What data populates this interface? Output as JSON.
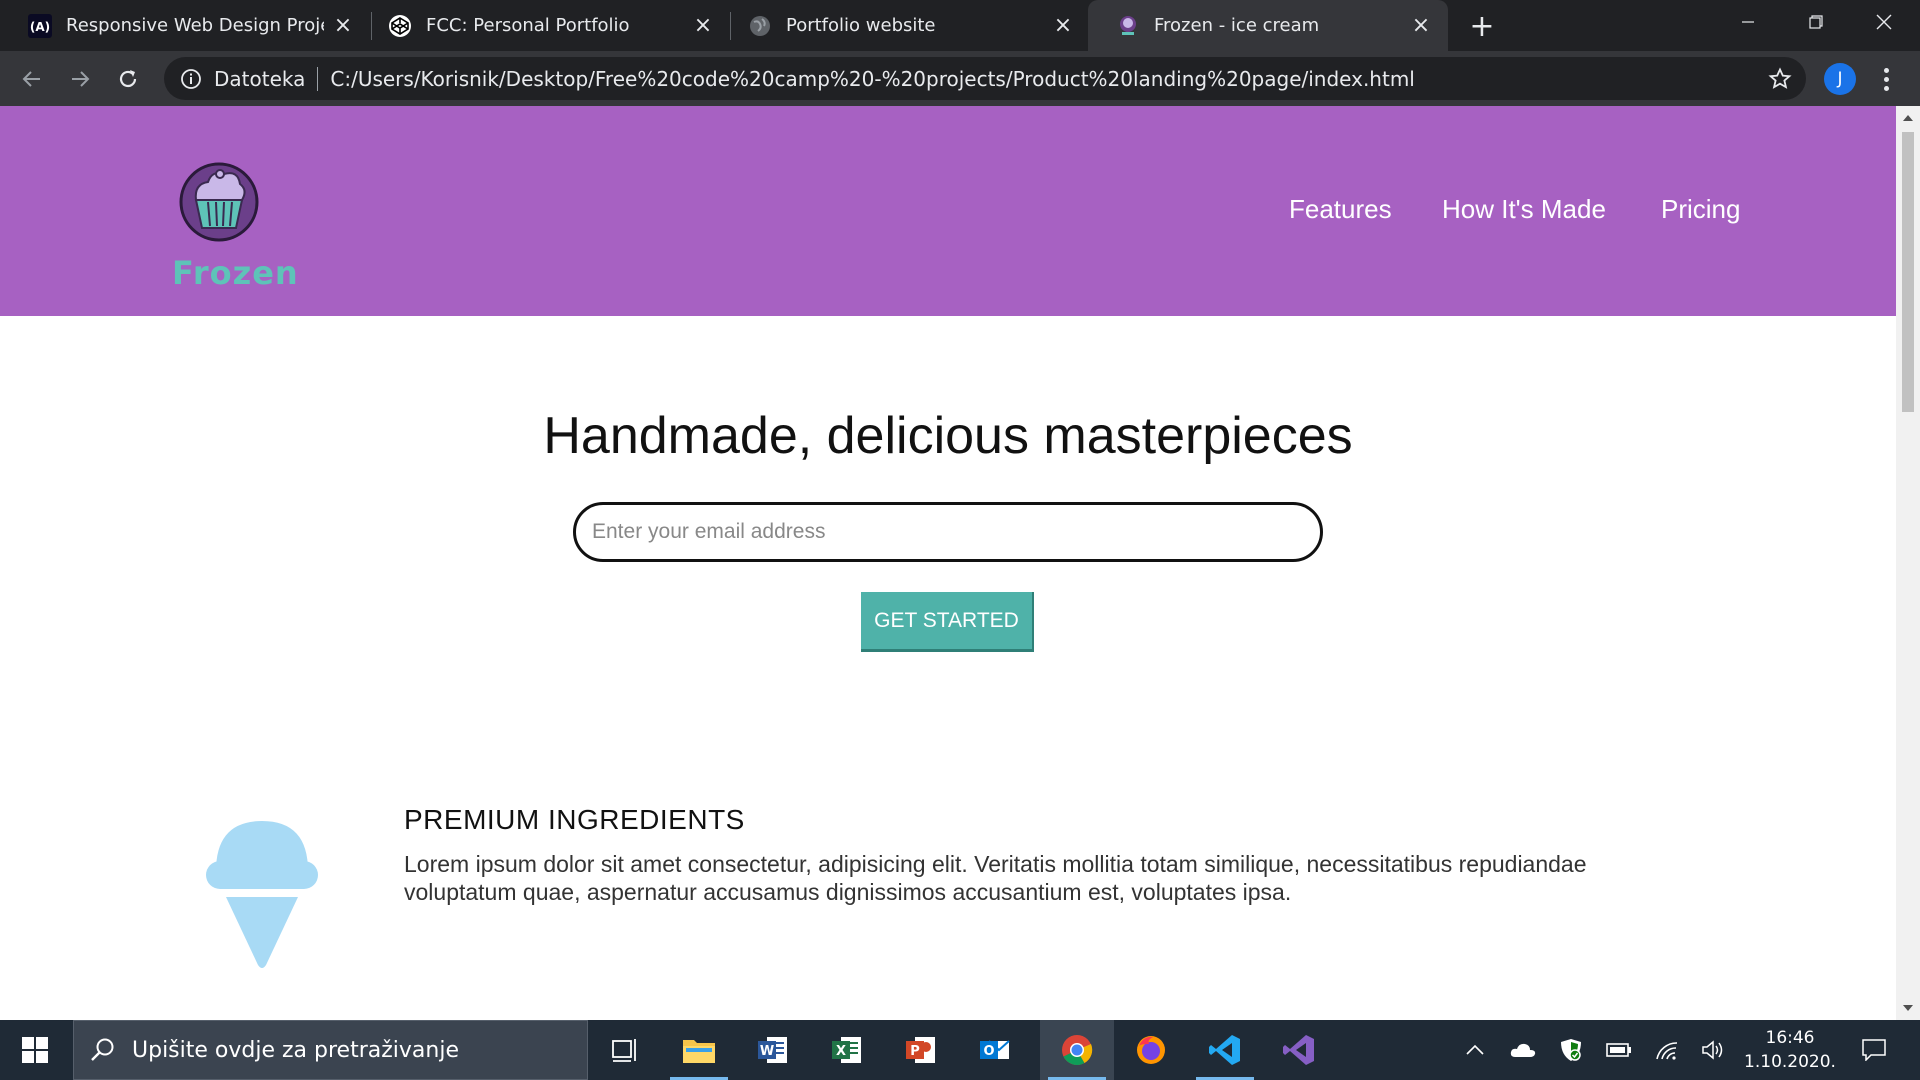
{
  "browser": {
    "tabs": [
      {
        "title": "Responsive Web Design Projects",
        "favicon": "freecodecamp-icon",
        "active": false
      },
      {
        "title": "FCC: Personal Portfolio",
        "favicon": "codepen-icon",
        "active": false
      },
      {
        "title": "Portfolio website",
        "favicon": "globe-icon",
        "active": false
      },
      {
        "title": "Frozen - ice cream",
        "favicon": "frozen-icon",
        "active": true
      }
    ],
    "scheme_label": "Datoteka",
    "url": "C:/Users/Korisnik/Desktop/Free%20code%20camp%20-%20projects/Product%20landing%20page/index.html",
    "profile_initial": "J"
  },
  "site": {
    "brand": "Frozen",
    "nav": [
      "Features",
      "How It's Made",
      "Pricing"
    ],
    "hero_title": "Handmade, delicious masterpieces",
    "email_placeholder": "Enter your email address",
    "cta_label": "GET STARTED",
    "feature": {
      "heading": "PREMIUM INGREDIENTS",
      "text": "Lorem ipsum dolor sit amet consectetur, adipisicing elit. Veritatis mollitia totam similique, necessitatibus repudiandae voluptatum quae, aspernatur accusamus dignissimos accusantium est, voluptates ipsa."
    },
    "colors": {
      "header": "#a761c2",
      "cta": "#4fb2a9",
      "brand_text": "#5ec3b8",
      "icon": "#a8daf5"
    }
  },
  "taskbar": {
    "search_placeholder": "Upišite ovdje za pretraživanje",
    "apps": [
      "task-view-icon",
      "file-explorer-icon",
      "word-icon",
      "excel-icon",
      "powerpoint-icon",
      "outlook-icon",
      "chrome-icon",
      "firefox-icon",
      "vscode-icon",
      "visual-studio-icon"
    ],
    "time": "16:46",
    "date": "1.10.2020."
  }
}
